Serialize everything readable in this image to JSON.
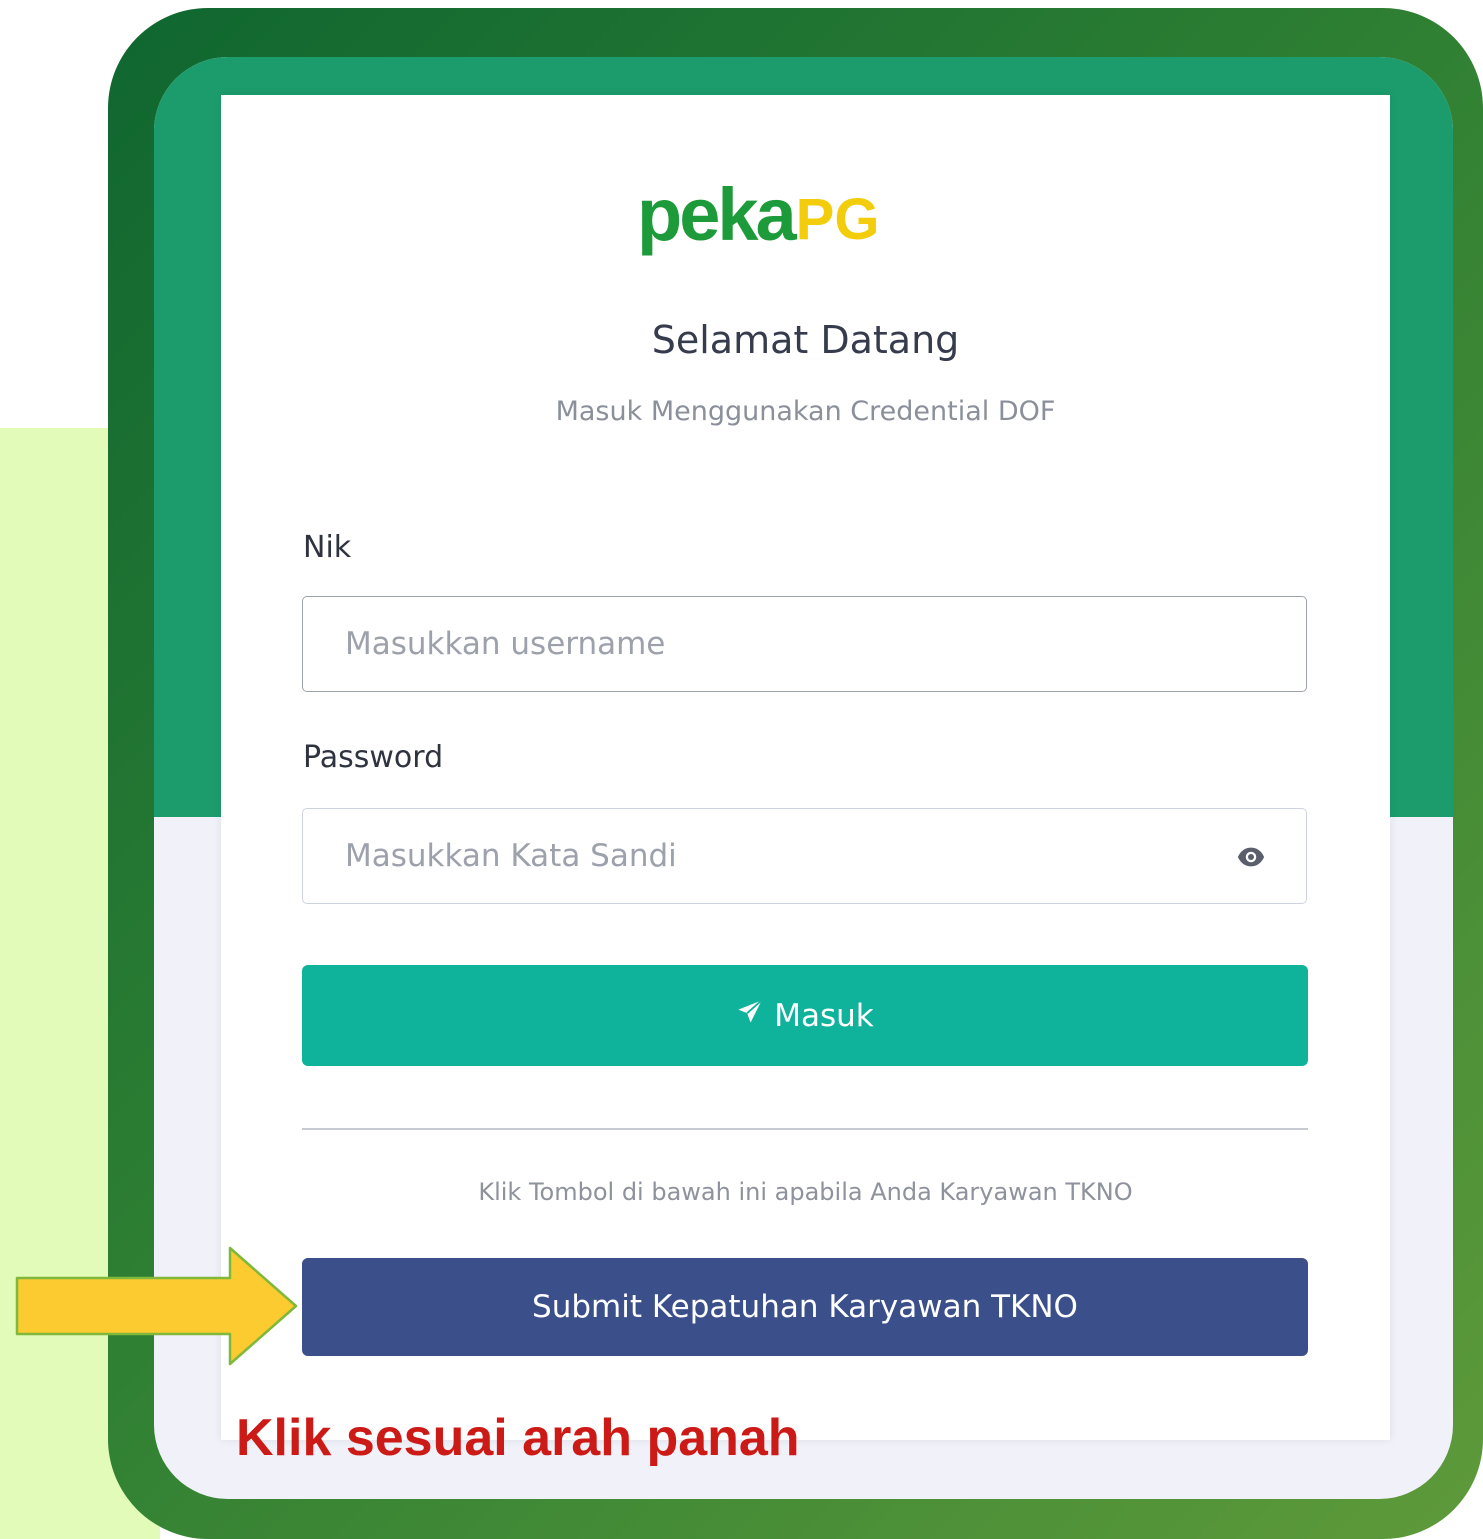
{
  "logo": {
    "part1": "peka",
    "part2": "PG"
  },
  "login": {
    "title": "Selamat Datang",
    "subtitle": "Masuk Menggunakan Credential DOF",
    "nik_label": "Nik",
    "nik_placeholder": "Masukkan username",
    "nik_value": "",
    "password_label": "Password",
    "password_placeholder": "Masukkan Kata Sandi",
    "password_value": "",
    "password_toggle_icon": "eye-icon",
    "submit_icon": "send-icon",
    "submit_label": "Masuk",
    "tkno_note": "Klik Tombol di bawah ini apabila Anda Karyawan TKNO",
    "tkno_button_label": "Submit Kepatuhan Karyawan TKNO"
  },
  "annotation": {
    "arrow_icon": "arrow-right-icon",
    "instruction": "Klik sesuai arah panah"
  },
  "colors": {
    "frame_green": "#2e7f33",
    "screen_green": "#1c9c6d",
    "masuk_button": "#0fb29b",
    "tkno_button": "#3b4f8a",
    "arrow_yellow": "#fbcb2f",
    "instruction_red": "#cc1b16",
    "logo_green": "#1d9a3a",
    "logo_yellow": "#f3cc0c",
    "left_panel": "#e2fbb8"
  }
}
